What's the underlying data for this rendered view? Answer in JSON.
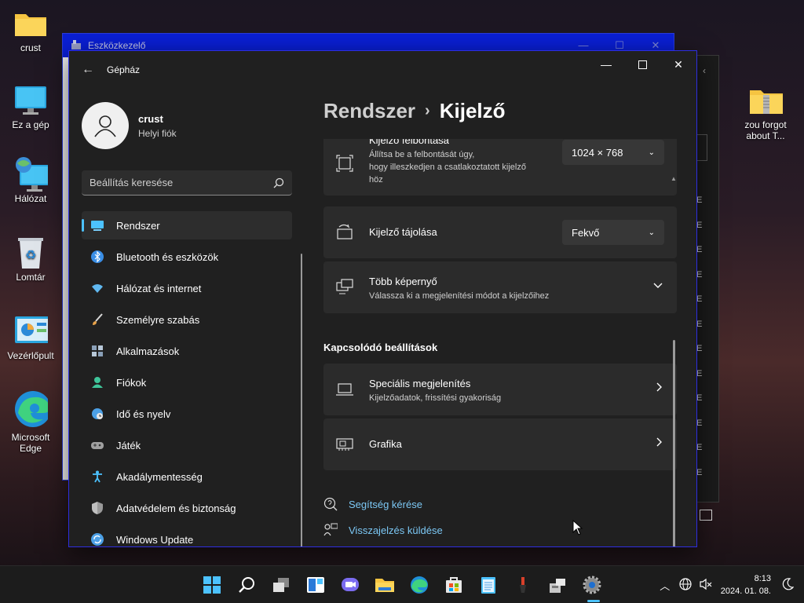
{
  "desktop": {
    "icons": [
      {
        "label": "crust"
      },
      {
        "label": "Ez a gép"
      },
      {
        "label": "Hálózat"
      },
      {
        "label": "Lomtár"
      },
      {
        "label": "Vezérlőpult"
      },
      {
        "label": "Microsoft Edge"
      },
      {
        "label": "zou forgot about T..."
      }
    ]
  },
  "background_window": {
    "title": "Eszközkezelő",
    "column_glyph": "E"
  },
  "settings": {
    "app_title": "Gépház",
    "profile": {
      "name": "crust",
      "type": "Helyi fiók"
    },
    "search_placeholder": "Beállítás keresése",
    "nav": [
      {
        "label": "Rendszer",
        "icon": "system-icon",
        "color": "#4cc2ff"
      },
      {
        "label": "Bluetooth és eszközök",
        "icon": "bluetooth-icon",
        "color": "#3a8ee6"
      },
      {
        "label": "Hálózat és internet",
        "icon": "wifi-icon",
        "color": "#60b8f0"
      },
      {
        "label": "Személyre szabás",
        "icon": "brush-icon",
        "color": "#e6a24a"
      },
      {
        "label": "Alkalmazások",
        "icon": "apps-icon",
        "color": "#8aa0b8"
      },
      {
        "label": "Fiókok",
        "icon": "account-icon",
        "color": "#3fc59a"
      },
      {
        "label": "Idő és nyelv",
        "icon": "globe-clock-icon",
        "color": "#4ca0e6"
      },
      {
        "label": "Játék",
        "icon": "gamepad-icon",
        "color": "#a0a0a0"
      },
      {
        "label": "Akadálymentesség",
        "icon": "accessibility-icon",
        "color": "#4cc2ff"
      },
      {
        "label": "Adatvédelem és biztonság",
        "icon": "shield-icon",
        "color": "#9a9a9a"
      },
      {
        "label": "Windows Update",
        "icon": "update-icon",
        "color": "#4ca0e6"
      }
    ],
    "breadcrumb": {
      "parent": "Rendszer",
      "current": "Kijelző"
    },
    "resolution": {
      "title": "Kijelző felbontása",
      "desc_1": "Állítsa be a felbontását úgy,",
      "desc_2": "hogy illeszkedjen a csatlakoztatott kijelző",
      "desc_3": "höz",
      "value": "1024 × 768"
    },
    "orientation": {
      "title": "Kijelző tájolása",
      "value": "Fekvő"
    },
    "multi": {
      "title": "Több képernyő",
      "desc": "Válassza ki a megjelenítési módot a kijelzőihez"
    },
    "related_header": "Kapcsolódó beállítások",
    "advanced": {
      "title": "Speciális megjelenítés",
      "desc": "Kijelzőadatok, frissítési gyakoriság"
    },
    "graphics": {
      "title": "Grafika"
    },
    "help": "Segítség kérése",
    "feedback": "Visszajelzés küldése"
  },
  "taskbar": {
    "icons": [
      "start-icon",
      "search-icon",
      "task-view-icon",
      "widgets-icon",
      "chat-icon",
      "file-explorer-icon",
      "edge-icon",
      "store-icon",
      "notepad-icon",
      "paint-icon",
      "device-manager-icon",
      "settings-icon"
    ],
    "time": "8:13",
    "date": "2024. 01. 08."
  },
  "colors": {
    "accent": "#4cc2ff",
    "link": "#7cc8f5",
    "window_bg": "#202020",
    "card_bg": "#2b2b2b"
  }
}
